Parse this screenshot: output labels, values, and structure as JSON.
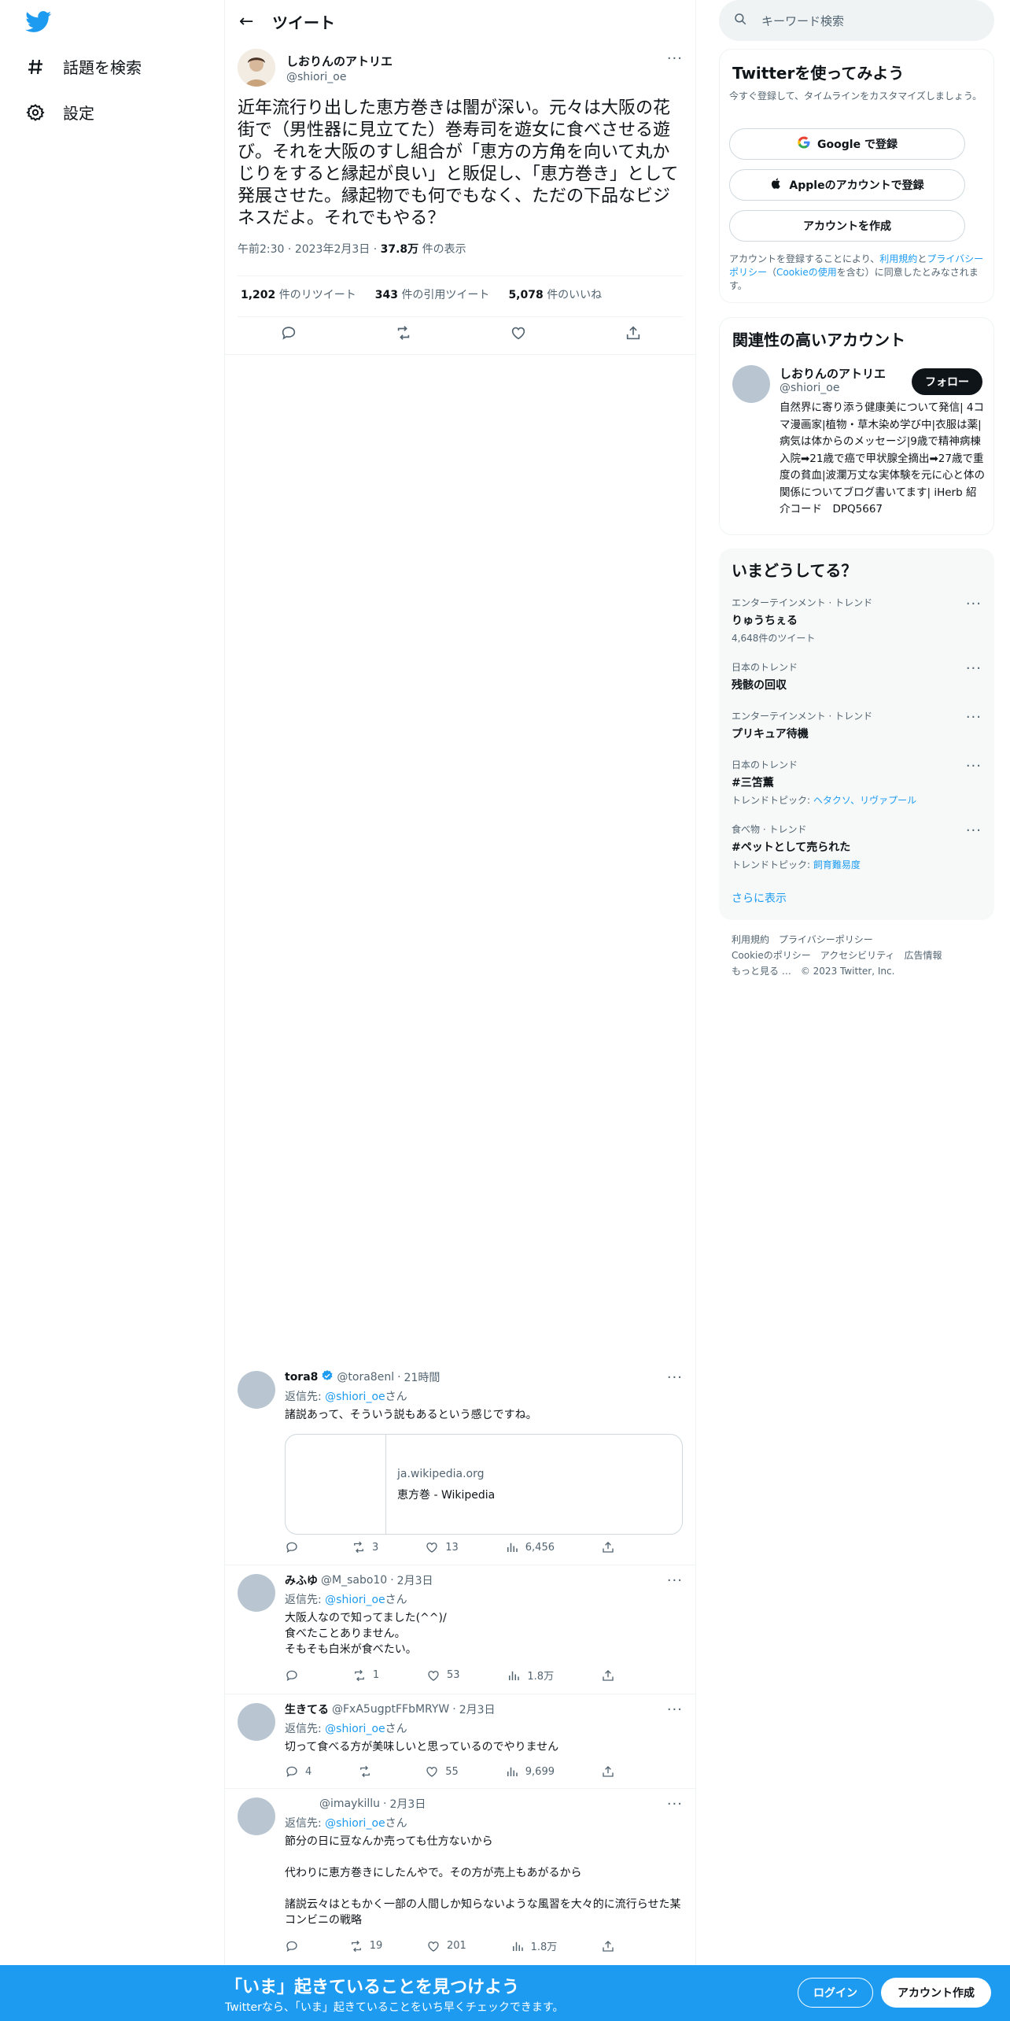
{
  "nav": {
    "explore_label": "話題を検索",
    "settings_label": "設定"
  },
  "header": {
    "title": "ツイート",
    "back_glyph": "←"
  },
  "tweet": {
    "author_name": "しおりんのアトリエ",
    "author_handle": "@shiori_oe",
    "text": "近年流行り出した恵方巻きは闇が深い。元々は大阪の花街で（男性器に見立てた）巻寿司を遊女に食べさせる遊び。それを大阪のすし組合が「恵方の方角を向いて丸かじりをすると縁起が良い」と販促し、「恵方巻き」として発展させた。縁起物でも何でもなく、ただの下品なビジネスだよ。それでもやる？",
    "time": "午前2:30",
    "date": "2023年2月3日",
    "views_count": "37.8万",
    "views_label": "件の表示",
    "retweets_count": "1,202",
    "retweets_label": "件のリツイート",
    "quotes_count": "343",
    "quotes_label": "件の引用ツイート",
    "likes_count": "5,078",
    "likes_label": "件のいいね"
  },
  "replies": [
    {
      "name": "tora8",
      "verified": true,
      "handle": "@tora8enl",
      "time": "21時間",
      "replying_prefix": "返信先: ",
      "replying_to": "@shiori_oe",
      "replying_suffix": "さん",
      "text": "諸説あって、そういう説もあるという感じですね。",
      "link_domain": "ja.wikipedia.org",
      "link_title": "恵方巻 - Wikipedia",
      "replies": "",
      "retweets": "3",
      "likes": "13",
      "views": "6,456"
    },
    {
      "name": "みふゆ",
      "handle": "@M_sabo10",
      "time": "2月3日",
      "replying_prefix": "返信先: ",
      "replying_to": "@shiori_oe",
      "replying_suffix": "さん",
      "line1": "大阪人なので知ってました(^^)/",
      "line2": "食べたことありません。",
      "line3": "そもそも白米が食べたい。",
      "replies": "",
      "retweets": "1",
      "likes": "53",
      "views": "1.8万"
    },
    {
      "name": "生きてる",
      "handle": "@FxA5ugptFFbMRYW",
      "time": "2月3日",
      "replying_prefix": "返信先: ",
      "replying_to": "@shiori_oe",
      "replying_suffix": "さん",
      "text": "切って食べる方が美味しいと思っているのでやりません",
      "replies": "4",
      "retweets": "",
      "likes": "55",
      "views": "9,699"
    },
    {
      "name": "",
      "handle": "@imaykillu",
      "time": "2月3日",
      "replying_prefix": "返信先: ",
      "replying_to": "@shiori_oe",
      "replying_suffix": "さん",
      "line1": "節分の日に豆なんか売っても仕方ないから",
      "line2": "代わりに恵方巻きにしたんやで。その方が売上もあがるから",
      "line3": "諸説云々はともかく一部の人間しか知らないような風習を大々的に流行らせた某コンビニの戦略",
      "replies": "",
      "retweets": "19",
      "likes": "201",
      "views": "1.8万"
    }
  ],
  "search": {
    "placeholder": "キーワード検索"
  },
  "signup": {
    "title": "Twitterを使ってみよう",
    "subtitle": "今すぐ登録して、タイムラインをカスタマイズしましょう。",
    "google_label": "Google で登録",
    "apple_label": "Appleのアカウントで登録",
    "create_label": "アカウントを作成",
    "terms_pre": "アカウントを登録することにより、",
    "terms_link": "利用規約",
    "terms_and": "と",
    "privacy_link": "プライバシーポリシー",
    "paren_open": "（",
    "cookie_link": "Cookieの使用",
    "terms_post": "を含む）に同意したとみなされます。"
  },
  "relevant": {
    "title": "関連性の高いアカウント",
    "name": "しおりんのアトリエ",
    "handle": "@shiori_oe",
    "follow_label": "フォロー",
    "bio": "自然界に寄り添う健康美について発信| 4コマ漫画家|植物・草木染め学び中|衣服は薬|病気は体からのメッセージ|9歳で精神病棟入院➡21歳で癌で甲状腺全摘出➡27歳で重度の貧血|波瀾万丈な実体験を元に心と体の関係についてブログ書いてます| iHerb 紹介コード　DPQ5667"
  },
  "trends": {
    "title": "いまどうしてる？",
    "items": [
      {
        "category": "エンターテインメント · トレンド",
        "name": "りゅうちぇる",
        "sub": "4,648件のツイート"
      },
      {
        "category": "日本のトレンド",
        "name": "残骸の回収",
        "sub": ""
      },
      {
        "category": "エンターテインメント · トレンド",
        "name": "プリキュア待機",
        "sub": ""
      },
      {
        "category": "日本のトレンド",
        "name": "#三笘薫",
        "sub_prefix": "トレンドトピック: ",
        "sub_links": "ヘタクソ、リヴァプール"
      },
      {
        "category": "食べ物 · トレンド",
        "name": "#ペットとして売られた",
        "sub_prefix": "トレンドトピック: ",
        "sub_links": "飼育難易度"
      }
    ],
    "show_more": "さらに表示"
  },
  "footer": {
    "terms": "利用規約",
    "privacy": "プライバシーポリシー",
    "cookie": "Cookieのポリシー",
    "accessibility": "アクセシビリティ",
    "ads": "広告情報",
    "more": "もっと見る …",
    "copyright": "© 2023 Twitter, Inc."
  },
  "bottom_bar": {
    "headline": "「いま」起きていることを見つけよう",
    "sub": "Twitterなら、「いま」起きていることをいち早くチェックできます。",
    "login_label": "ログイン",
    "signup_label": "アカウント作成"
  },
  "colors": {
    "accent": "#1d9bf0",
    "text": "#0f1419",
    "muted": "#536471",
    "border": "#eff3f4"
  }
}
